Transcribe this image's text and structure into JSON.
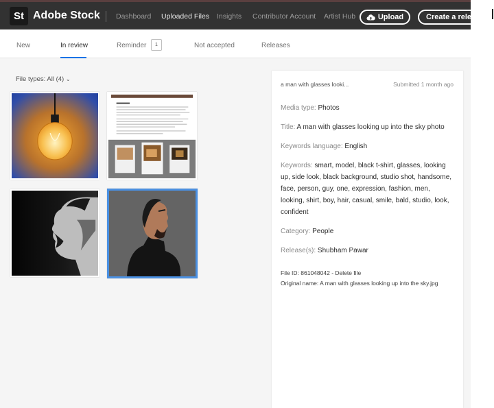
{
  "app": {
    "logo_text": "St",
    "brand": "Adobe Stock",
    "accent_color": "#1473e6"
  },
  "nav": {
    "items": [
      "Dashboard",
      "Uploaded Files",
      "Insights",
      "Contributor Account",
      "Artist Hub"
    ],
    "active": "Uploaded Files",
    "upload_label": "Upload",
    "create_release_label": "Create a release"
  },
  "tabs": {
    "new": "New",
    "in_review": "In review",
    "reminder": "Reminder",
    "reminder_count": "1",
    "not_accepted": "Not accepted",
    "releases": "Releases"
  },
  "filter": {
    "label": "File types: All (4)",
    "chevron": "⌄"
  },
  "thumbnails": [
    {
      "name": "light-bulb-thumbnail"
    },
    {
      "name": "document-thumbnail"
    },
    {
      "name": "shouting-man-thumbnail"
    },
    {
      "name": "man-looking-up-thumbnail",
      "selected": true
    }
  ],
  "detail": {
    "header_title": "a man with glasses looki...",
    "submitted": "Submitted 1 month ago",
    "media_type_label": "Media type:",
    "media_type": "Photos",
    "title_label": "Title:",
    "title": "A man with glasses looking up into the sky photo",
    "keywords_language_label": "Keywords language:",
    "keywords_language": "English",
    "keywords_label": "Keywords:",
    "keywords": "smart, model, black t-shirt, glasses, looking up, side look, black background, studio shot, handsome, face, person, guy, one, expression, fashion, men, looking, shirt, boy, hair, casual, smile, bald, studio, look, confident",
    "category_label": "Category:",
    "category": "People",
    "releases_label": "Release(s):",
    "releases": "Shubham Pawar",
    "file_id": "File ID: 861048042 - Delete file",
    "original_name": "Original name: A man with glasses looking up into the sky.jpg"
  }
}
